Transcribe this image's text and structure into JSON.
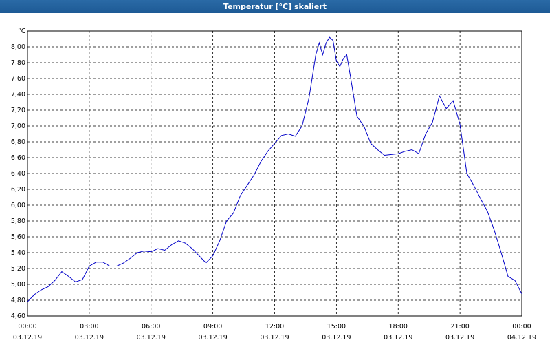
{
  "window": {
    "title": "Temperatur [°C] skaliert"
  },
  "chart_data": {
    "type": "line",
    "title": "Temperatur [°C] skaliert",
    "ylabel": "°C",
    "xlabel": "",
    "ylim": [
      4.6,
      8.2
    ],
    "xlim_hours": [
      0,
      24
    ],
    "grid": true,
    "legend": "none",
    "y_ticks": [
      "4,60",
      "4,80",
      "5,00",
      "5,20",
      "5,40",
      "5,60",
      "5,80",
      "6,00",
      "6,20",
      "6,40",
      "6,60",
      "6,80",
      "7,00",
      "7,20",
      "7,40",
      "7,60",
      "7,80",
      "8,00"
    ],
    "x_ticks": [
      {
        "time": "00:00",
        "date": "03.12.19"
      },
      {
        "time": "03:00",
        "date": "03.12.19"
      },
      {
        "time": "06:00",
        "date": "03.12.19"
      },
      {
        "time": "09:00",
        "date": "03.12.19"
      },
      {
        "time": "12:00",
        "date": "03.12.19"
      },
      {
        "time": "15:00",
        "date": "03.12.19"
      },
      {
        "time": "18:00",
        "date": "03.12.19"
      },
      {
        "time": "21:00",
        "date": "03.12.19"
      },
      {
        "time": "00:00",
        "date": "04.12.19"
      }
    ],
    "series": [
      {
        "color": "#0000c8",
        "x": [
          "00:00",
          "00:20",
          "00:40",
          "01:00",
          "01:20",
          "01:40",
          "02:00",
          "02:20",
          "02:40",
          "03:00",
          "03:20",
          "03:40",
          "04:00",
          "04:20",
          "04:40",
          "05:00",
          "05:20",
          "05:40",
          "06:00",
          "06:20",
          "06:40",
          "07:00",
          "07:20",
          "07:40",
          "08:00",
          "08:20",
          "08:40",
          "09:00",
          "09:20",
          "09:40",
          "10:00",
          "10:20",
          "10:40",
          "11:00",
          "11:20",
          "11:40",
          "12:00",
          "12:20",
          "12:40",
          "13:00",
          "13:20",
          "13:40",
          "14:00",
          "14:10",
          "14:20",
          "14:30",
          "14:40",
          "14:50",
          "15:00",
          "15:10",
          "15:20",
          "15:30",
          "15:40",
          "16:00",
          "16:20",
          "16:40",
          "17:00",
          "17:20",
          "17:40",
          "18:00",
          "18:20",
          "18:40",
          "19:00",
          "19:20",
          "19:40",
          "20:00",
          "20:20",
          "20:40",
          "21:00",
          "21:20",
          "21:40",
          "22:00",
          "22:20",
          "22:40",
          "23:00",
          "23:20",
          "23:40",
          "00:00"
        ],
        "y": [
          4.78,
          4.87,
          4.93,
          4.97,
          5.05,
          5.16,
          5.1,
          5.03,
          5.06,
          5.23,
          5.28,
          5.28,
          5.23,
          5.23,
          5.27,
          5.33,
          5.4,
          5.42,
          5.41,
          5.45,
          5.43,
          5.5,
          5.55,
          5.52,
          5.45,
          5.36,
          5.27,
          5.36,
          5.55,
          5.8,
          5.9,
          6.12,
          6.25,
          6.38,
          6.55,
          6.68,
          6.78,
          6.88,
          6.9,
          6.87,
          7.0,
          7.35,
          7.9,
          8.05,
          7.9,
          8.05,
          8.12,
          8.08,
          7.82,
          7.75,
          7.85,
          7.9,
          7.65,
          7.12,
          7.0,
          6.78,
          6.7,
          6.63,
          6.64,
          6.65,
          6.68,
          6.7,
          6.65,
          6.9,
          7.05,
          7.38,
          7.22,
          7.32,
          7.02,
          6.4,
          6.25,
          6.08,
          5.92,
          5.68,
          5.4,
          5.1,
          5.05,
          4.88
        ]
      }
    ]
  }
}
